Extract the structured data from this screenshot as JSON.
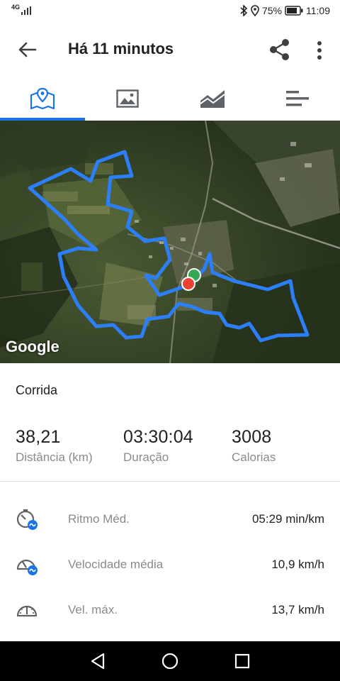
{
  "status_bar": {
    "network": "4G",
    "battery_percent": "75%",
    "time": "11:09"
  },
  "app_bar": {
    "title": "Há 11 minutos",
    "icons": [
      "back-arrow-icon",
      "share-icon",
      "more-vert-icon"
    ]
  },
  "tabs": [
    {
      "name": "map",
      "icon": "map-pin-icon",
      "active": true
    },
    {
      "name": "photos",
      "icon": "image-icon",
      "active": false
    },
    {
      "name": "charts",
      "icon": "area-chart-icon",
      "active": false
    },
    {
      "name": "splits",
      "icon": "bar-list-icon",
      "active": false
    }
  ],
  "map": {
    "provider_logo": "Google",
    "route_color": "#2d7ff9",
    "start_marker_color": "#34a853",
    "end_marker_color": "#ea4335"
  },
  "activity": {
    "type": "Corrida"
  },
  "metrics": [
    {
      "value": "38,21",
      "label": "Distância (km)"
    },
    {
      "value": "03:30:04",
      "label": "Duração"
    },
    {
      "value": "3008",
      "label": "Calorias"
    }
  ],
  "stats": [
    {
      "icon": "pace-timer-icon",
      "label": "Ritmo Méd.",
      "value": "05:29 min/km"
    },
    {
      "icon": "speedometer-avg-icon",
      "label": "Velocidade média",
      "value": "10,9 km/h"
    },
    {
      "icon": "speedometer-icon",
      "label": "Vel. máx.",
      "value": "13,7 km/h"
    }
  ],
  "colors": {
    "accent": "#1a73e8",
    "text_primary": "#202124",
    "text_secondary": "#8a8a8a"
  }
}
